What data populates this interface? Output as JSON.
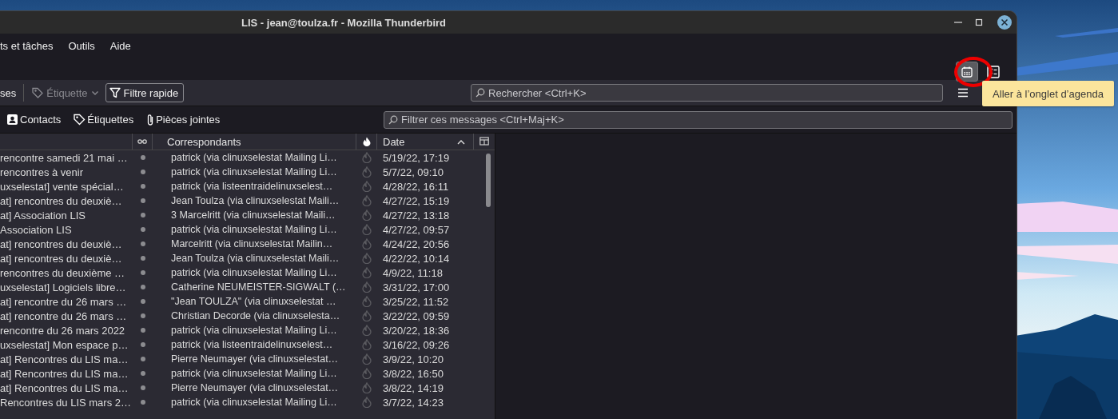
{
  "window": {
    "title": "LIS - jean@toulza.fr - Mozilla Thunderbird"
  },
  "menu": [
    "ts et tâches",
    "Outils",
    "Aide"
  ],
  "spaces": [
    {
      "kind": "calendar",
      "highlighted": true
    },
    {
      "kind": "tasks",
      "highlighted": false
    }
  ],
  "annotation": {
    "kind": "circle"
  },
  "tooltip": {
    "text": "Aller à l’onglet d’agenda"
  },
  "toolbar": {
    "cut_label": "ses",
    "tag_button": {
      "label": "Étiquette",
      "disabled": true
    },
    "quick_filter_button": {
      "label": "Filtre rapide"
    },
    "search": {
      "placeholder": "Rechercher <Ctrl+K>"
    }
  },
  "quick_filter": {
    "buttons": [
      {
        "kind": "contacts",
        "label": "Contacts"
      },
      {
        "kind": "tags",
        "label": "Étiquettes"
      },
      {
        "kind": "attachments",
        "label": "Pièces jointes"
      }
    ],
    "filter": {
      "placeholder": "Filtrer ces messages <Ctrl+Maj+K>"
    }
  },
  "table": {
    "columns": [
      {
        "kind": "blank"
      },
      {
        "kind": "thread"
      },
      {
        "kind": "text",
        "label": "Correspondants",
        "sorted": false
      },
      {
        "kind": "junk"
      },
      {
        "kind": "text",
        "label": "Date",
        "sorted": true
      },
      {
        "kind": "picker"
      }
    ],
    "rows": [
      {
        "subject": "rencontre samedi 21 mai …",
        "correspondent": "patrick (via clinuxselestat Mailing Li…",
        "date": "5/19/22, 17:19"
      },
      {
        "subject": "rencontres à venir",
        "correspondent": "patrick (via clinuxselestat Mailing Li…",
        "date": "5/7/22, 09:10"
      },
      {
        "subject": "uxselestat] vente spécial…",
        "correspondent": "patrick (via listeentraidelinuxselest…",
        "date": "4/28/22, 16:11"
      },
      {
        "subject": "at] rencontres du deuxiè…",
        "correspondent": "Jean Toulza (via clinuxselestat Maili…",
        "date": "4/27/22, 15:19"
      },
      {
        "subject": "at] Association LIS",
        "correspondent": "3 Marcelritt (via clinuxselestat Maili…",
        "date": "4/27/22, 13:18"
      },
      {
        "subject": "Association LIS",
        "correspondent": "patrick (via clinuxselestat Mailing Li…",
        "date": "4/27/22, 09:57"
      },
      {
        "subject": "at] rencontres du deuxiè…",
        "correspondent": "Marcelritt (via clinuxselestat Mailin…",
        "date": "4/24/22, 20:56"
      },
      {
        "subject": "at] rencontres du deuxiè…",
        "correspondent": "Jean Toulza (via clinuxselestat Maili…",
        "date": "4/22/22, 10:14"
      },
      {
        "subject": "rencontres du deuxième …",
        "correspondent": "patrick (via clinuxselestat Mailing Li…",
        "date": "4/9/22, 11:18"
      },
      {
        "subject": "uxselestat] Logiciels libre…",
        "correspondent": "Catherine NEUMEISTER-SIGWALT (…",
        "date": "3/31/22, 17:00"
      },
      {
        "subject": "at] rencontre du 26 mars …",
        "correspondent": "\"Jean TOULZA\" (via clinuxselestat …",
        "date": "3/25/22, 11:52"
      },
      {
        "subject": "at] rencontre du 26 mars …",
        "correspondent": "Christian Decorde (via clinuxselesta…",
        "date": "3/22/22, 09:59"
      },
      {
        "subject": "rencontre du 26 mars 2022",
        "correspondent": "patrick (via clinuxselestat Mailing Li…",
        "date": "3/20/22, 18:36"
      },
      {
        "subject": "uxselestat] Mon espace p…",
        "correspondent": "patrick (via listeentraidelinuxselest…",
        "date": "3/16/22, 09:26"
      },
      {
        "subject": "at] Rencontres du LIS ma…",
        "correspondent": "Pierre Neumayer (via clinuxselestat…",
        "date": "3/9/22, 10:20"
      },
      {
        "subject": "at] Rencontres du LIS ma…",
        "correspondent": "patrick (via clinuxselestat Mailing Li…",
        "date": "3/8/22, 16:50"
      },
      {
        "subject": "at] Rencontres du LIS ma…",
        "correspondent": "Pierre Neumayer (via clinuxselestat…",
        "date": "3/8/22, 14:19"
      },
      {
        "subject": "Rencontres du LIS mars 2…",
        "correspondent": "patrick (via clinuxselestat Mailing Li…",
        "date": "3/7/22, 14:23"
      }
    ]
  }
}
